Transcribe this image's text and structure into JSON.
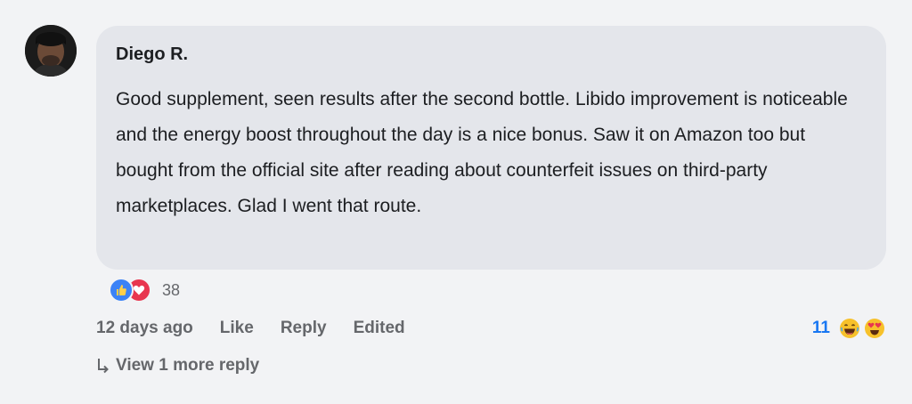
{
  "comment": {
    "author": "Diego R.",
    "text": "Good supplement, seen results after the second bottle. Libido improvement is noticeable and the energy boost throughout the day is a nice bonus. Saw it on Amazon too but bought from the official site after reading about counterfeit issues on third-party marketplaces. Glad I went that route.",
    "reaction_icons": [
      "thumbs-up-icon",
      "heart-icon"
    ],
    "reaction_count": "38",
    "timestamp": "12 days ago",
    "like_label": "Like",
    "reply_label": "Reply",
    "edited_label": "Edited",
    "right_reaction_count": "11",
    "right_reaction_icons": [
      "laughing-emoji-icon",
      "heart-eyes-emoji-icon"
    ],
    "more_replies_label": "View 1 more reply"
  },
  "colors": {
    "background": "#f2f3f5",
    "bubble": "#e4e6eb",
    "secondary_text": "#65676b",
    "accent_blue": "#1877f2",
    "like_blue": "#3b82f6",
    "love_red": "#e8364f",
    "emoji_yellow": "#f7c12b"
  }
}
